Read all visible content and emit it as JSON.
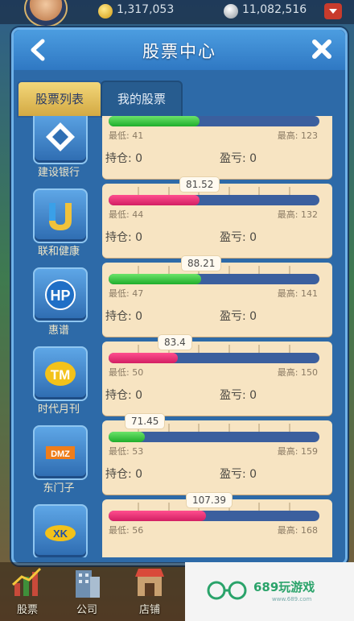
{
  "top": {
    "gold": "1,317,053",
    "silver": "11,082,516",
    "icons": {
      "gold": "gold-coin-icon",
      "silver": "silver-coin-icon",
      "menu": "dropdown-icon"
    }
  },
  "header": {
    "title": "股票中心",
    "back_icon": "back-arrow-icon",
    "close_icon": "close-icon"
  },
  "tabs": [
    {
      "label": "股票列表",
      "active": true
    },
    {
      "label": "我的股票",
      "active": false
    }
  ],
  "labels": {
    "low": "最低",
    "high": "最高",
    "hold": "持仓",
    "pnl": "盈亏"
  },
  "stocks": [
    {
      "name": "建设银行",
      "price": "",
      "low": "41",
      "high": "123",
      "hold": "0",
      "pnl": "0",
      "bar": "green",
      "level": 0.43,
      "icon": "diamond-logo-icon"
    },
    {
      "name": "联和健康",
      "price": "81.52",
      "low": "44",
      "high": "132",
      "hold": "0",
      "pnl": "0",
      "bar": "pink",
      "level": 0.43,
      "icon": "u-logo-icon"
    },
    {
      "name": "惠谱",
      "price": "88.21",
      "low": "47",
      "high": "141",
      "hold": "0",
      "pnl": "0",
      "bar": "green",
      "level": 0.44,
      "icon": "hp-logo-icon"
    },
    {
      "name": "时代月刊",
      "price": "83.4",
      "low": "50",
      "high": "150",
      "hold": "0",
      "pnl": "0",
      "bar": "pink",
      "level": 0.33,
      "icon": "tm-logo-icon"
    },
    {
      "name": "东门子",
      "price": "71.45",
      "low": "53",
      "high": "159",
      "hold": "0",
      "pnl": "0",
      "bar": "green",
      "level": 0.17,
      "icon": "dmz-logo-icon"
    },
    {
      "name": "",
      "price": "107.39",
      "low": "56",
      "high": "168",
      "hold": "",
      "pnl": "",
      "bar": "pink",
      "level": 0.46,
      "icon": "xk-logo-icon"
    }
  ],
  "dock": [
    {
      "label": "股票",
      "icon": "stock-chart-icon"
    },
    {
      "label": "公司",
      "icon": "building-icon"
    },
    {
      "label": "店铺",
      "icon": "shop-icon"
    }
  ],
  "watermark": {
    "text": "689玩游戏",
    "sub": "www.689.com"
  }
}
